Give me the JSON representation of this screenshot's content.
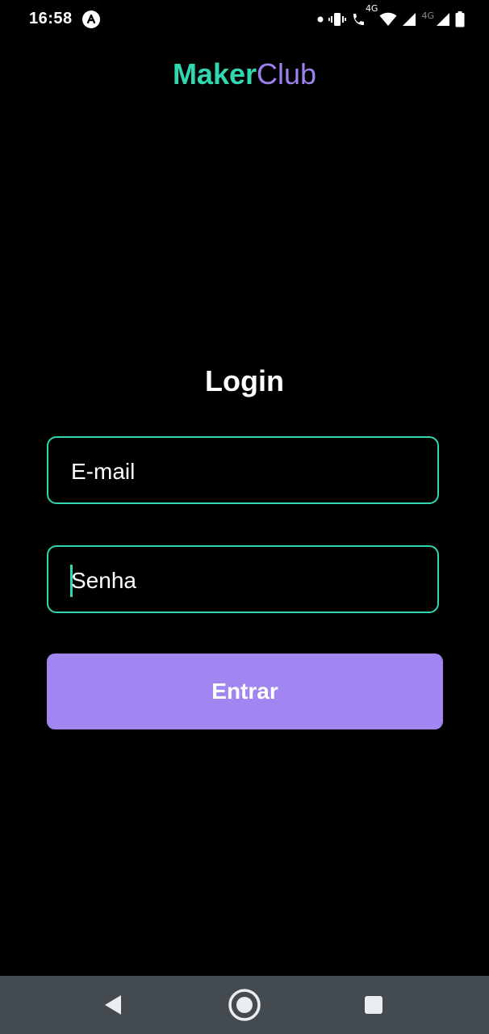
{
  "status_bar": {
    "time": "16:58",
    "network_label_1": "4G",
    "network_label_2": "4G"
  },
  "brand": {
    "part1": "Maker",
    "part2": "Club"
  },
  "login": {
    "title": "Login",
    "email_placeholder": "E-mail",
    "password_placeholder": "Senha",
    "submit_label": "Entrar"
  },
  "icons": [
    "app-notification-icon",
    "dot-icon",
    "vibrate-icon",
    "volte-call-icon",
    "wifi-icon",
    "signal-icon",
    "battery-icon",
    "back-icon",
    "home-icon",
    "recents-icon"
  ],
  "colors": {
    "background": "#000000",
    "accent_teal": "#2fd8b0",
    "accent_purple": "#9b82ee",
    "button": "#a185f0",
    "nav_bar": "#434a50"
  }
}
